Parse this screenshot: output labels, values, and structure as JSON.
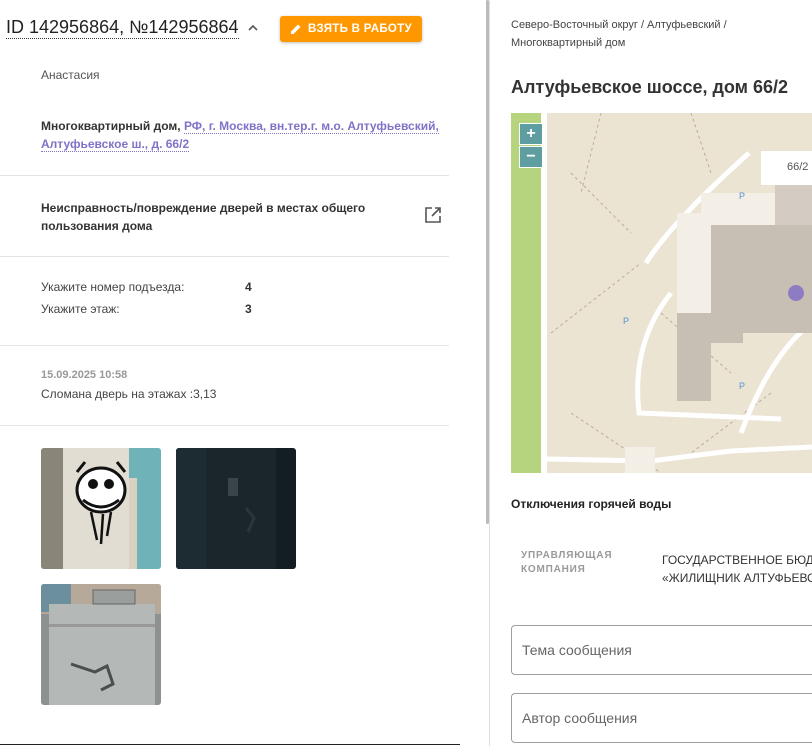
{
  "header": {
    "title": "ID 142956864, №142956864",
    "take_button": "ВЗЯТЬ В РАБОТУ"
  },
  "request": {
    "author_name": "Анастасия",
    "address_type": "Многоквартирный дом,",
    "address_link": "РФ, г. Москва, вн.тер.г. м.о. Алтуфьевский, Алтуфьевское ш., д. 66/2",
    "issue": "Неисправность/повреждение дверей в местах общего пользования дома",
    "fields": [
      {
        "label": "Укажите номер подъезда:",
        "value": "4"
      },
      {
        "label": "Укажите этаж:",
        "value": "3"
      }
    ],
    "date": "15.09.2025 10:58",
    "comment": "Сломана дверь на этажах :3,13"
  },
  "building": {
    "breadcrumb_1": "Северо-Восточный округ / Алтуфьевский /",
    "breadcrumb_2": "Многоквартирный дом",
    "title": "Алтуфьевское шоссе, дом 66/2",
    "map_building_label": "66/2",
    "zoom_in": "+",
    "zoom_out": "−",
    "parking_marker": "P",
    "hot_water": "Отключения горячей воды",
    "mc_label_1": "УПРАВЛЯЮЩАЯ",
    "mc_label_2": "КОМПАНИЯ",
    "mc_value_1": "ГОСУДАРСТВЕННОЕ БЮДЖЕТНОЕ",
    "mc_value_2": "«ЖИЛИЩНИК АЛТУФЬЕВСКОГО»"
  },
  "form": {
    "subject_placeholder": "Тема сообщения",
    "author_placeholder": "Автор сообщения"
  },
  "colors": {
    "accent": "#ff9800",
    "link": "#7f73c7",
    "map_marker": "#8e7cc3"
  }
}
